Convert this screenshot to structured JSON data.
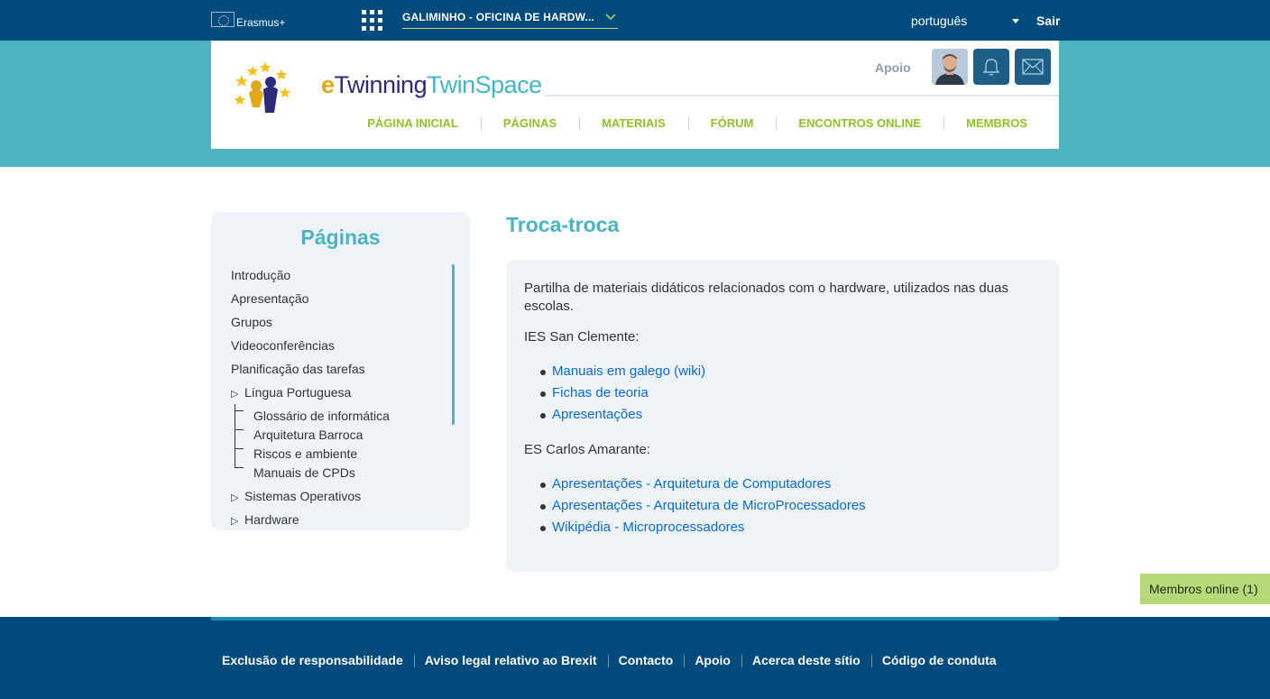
{
  "topbar": {
    "brand": "Erasmus+",
    "project_title": "GALIMINHO - OFICINA DE HARDW...",
    "language": "português",
    "logout_label": "Sair"
  },
  "header": {
    "logo": {
      "e": "e",
      "twinning": "Twinning",
      "twinspace": "TwinSpace"
    },
    "support_label": "Apoio",
    "nav": [
      {
        "label": "PÁGINA INICIAL"
      },
      {
        "label": "PÁGINAS"
      },
      {
        "label": "MATERIAIS"
      },
      {
        "label": "FÓRUM"
      },
      {
        "label": "ENCONTROS ONLINE"
      },
      {
        "label": "MEMBROS"
      }
    ]
  },
  "sidebar": {
    "title": "Páginas",
    "items": [
      {
        "label": "Introdução"
      },
      {
        "label": "Apresentação"
      },
      {
        "label": "Grupos"
      },
      {
        "label": "Videoconferências"
      },
      {
        "label": "Planificação das tarefas"
      },
      {
        "label": "Língua Portuguesa",
        "expandable": true
      },
      {
        "label": "Sistemas Operativos",
        "expandable": true
      },
      {
        "label": "Hardware",
        "expandable": true
      }
    ],
    "subitems": [
      {
        "label": "Glossário de informática"
      },
      {
        "label": "Arquitetura Barroca"
      },
      {
        "label": "Riscos e ambiente"
      },
      {
        "label": "Manuais de CPDs"
      }
    ]
  },
  "main": {
    "title": "Troca-troca",
    "intro": "Partilha de materiais didáticos relacionados com o hardware, utilizados nas duas escolas.",
    "sections": [
      {
        "label": "IES San Clemente:",
        "links": [
          "Manuais em galego (wiki)",
          "Fichas de teoria",
          "Apresentações"
        ]
      },
      {
        "label": "ES Carlos Amarante:",
        "links": [
          "Apresentações - Arquitetura de Computadores",
          "Apresentações - Arquitetura de MicroProcessadores",
          "Wikipédia - Microprocessadores"
        ]
      }
    ]
  },
  "online_members": "Membros online (1)",
  "footer": {
    "links": [
      "Exclusão de responsabilidade",
      "Aviso legal relativo ao Brexit",
      "Contacto",
      "Apoio",
      "Acerca deste sítio",
      "Código de conduta"
    ]
  },
  "colors": {
    "topbar": "#004a7c",
    "teal": "#4cb4c1",
    "nav_green": "#8fc12a",
    "link_blue": "#0a6ad5",
    "online_green": "#b7d97a"
  },
  "icons": [
    "eu-flag-icon",
    "apps-grid-icon",
    "chevron-down-icon",
    "caret-down-icon",
    "bell-icon",
    "mail-icon",
    "triangle-right-icon"
  ]
}
